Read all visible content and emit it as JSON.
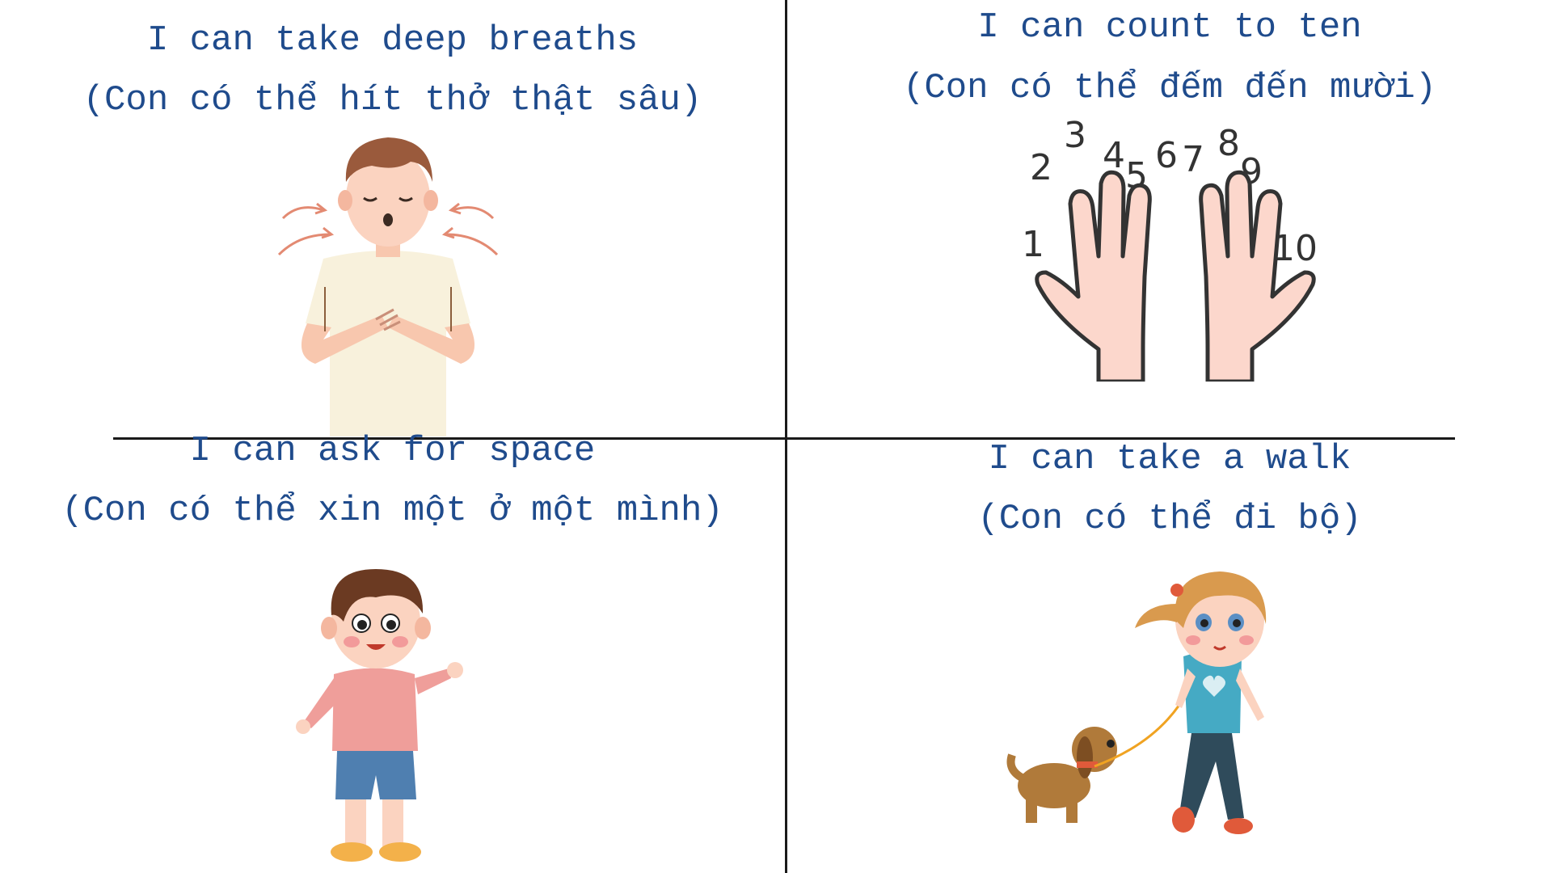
{
  "panels": [
    {
      "title": "I can take deep breaths",
      "subtitle": "(Con có thể hít thở thật sâu)",
      "icon": "breathing-boy-illustration"
    },
    {
      "title": "I can count to ten",
      "subtitle": "(Con có thể đếm đến mười)",
      "icon": "counting-hands-illustration",
      "numbers": [
        "1",
        "2",
        "3",
        "4",
        "5",
        "6",
        "7",
        "8",
        "9",
        "10"
      ]
    },
    {
      "title": "I can ask for space",
      "subtitle": "(Con có thể xin một ở một mình)",
      "icon": "waving-boy-illustration"
    },
    {
      "title": "I can take a walk",
      "subtitle": "(Con có thể đi bộ)",
      "icon": "girl-walking-dog-illustration"
    }
  ],
  "colors": {
    "caption": "#1f4b8c",
    "divider": "#1a1a1a",
    "skin": "#fbd3c0",
    "palm": "#fcd7cc"
  }
}
